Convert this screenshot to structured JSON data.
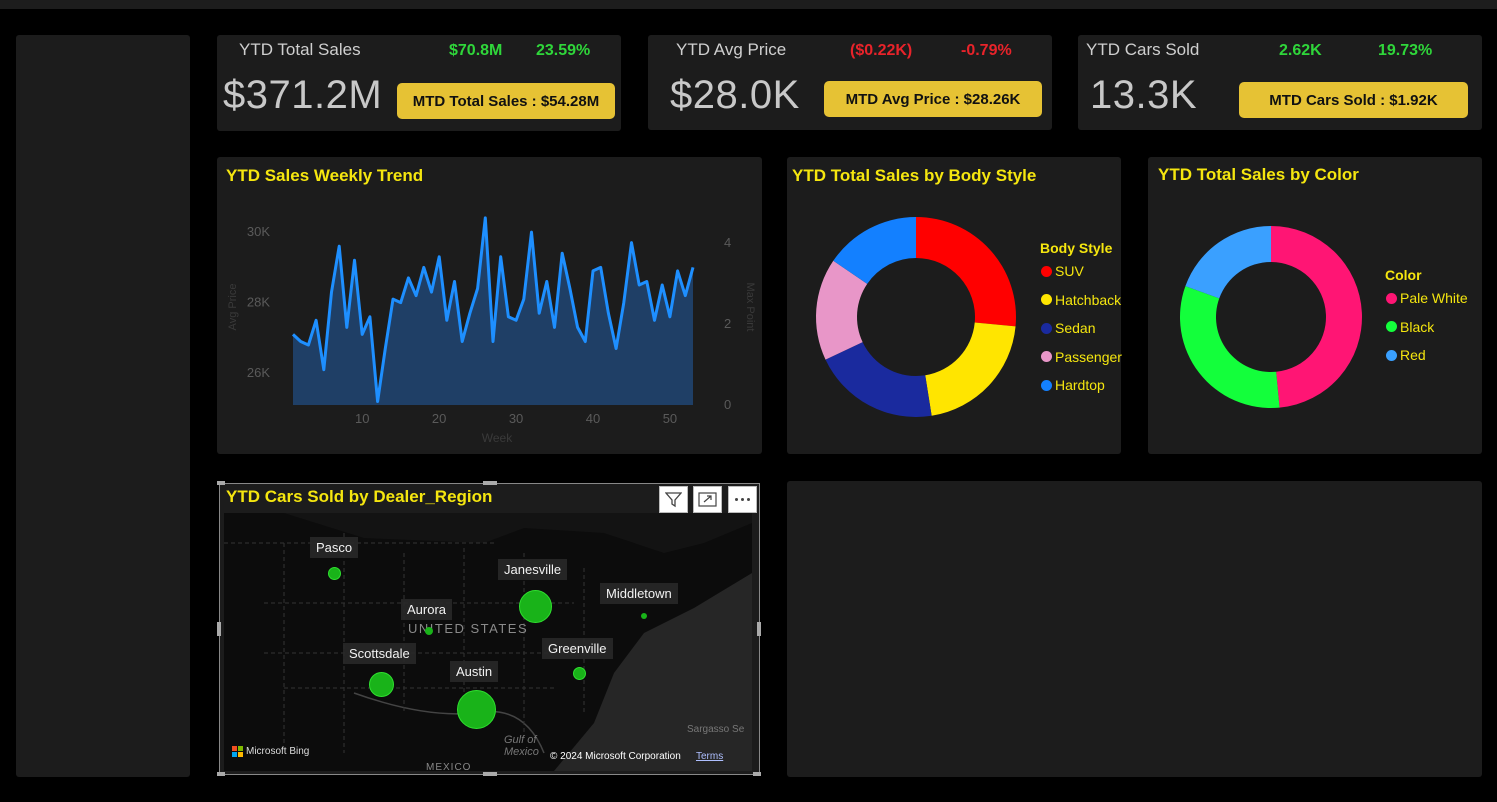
{
  "kpis": {
    "sales": {
      "label": "YTD Total Sales",
      "value": "$371.2M",
      "delta_abs": "$70.8M",
      "delta_pct": "23.59%",
      "mtd": "MTD Total Sales : $54.28M"
    },
    "price": {
      "label": "YTD Avg Price",
      "value": "$28.0K",
      "delta_abs": "($0.22K)",
      "delta_pct": "-0.79%",
      "mtd": "MTD Avg Price : $28.26K"
    },
    "cars": {
      "label": "YTD Cars Sold",
      "value": "13.3K",
      "delta_abs": "2.62K",
      "delta_pct": "19.73%",
      "mtd": "MTD Cars Sold : $1.92K"
    }
  },
  "colors": {
    "positive": "#2fd63a",
    "negative": "#e8232a",
    "accent": "#f5e60f",
    "button": "#e6c234",
    "line": "#1e8fff",
    "area": "#1f3f66"
  },
  "trend": {
    "title": "YTD Sales Weekly Trend",
    "left_axis_label": "Avg Price",
    "right_axis_label": "Max Point",
    "x_label": "Week",
    "chart_data": {
      "type": "area",
      "x_ticks": [
        "10",
        "20",
        "30",
        "40",
        "50"
      ],
      "y_ticks": [
        "26K",
        "28K",
        "30K"
      ],
      "y2_ticks": [
        "0",
        "2",
        "4"
      ],
      "x_range": [
        1,
        53
      ],
      "y_range": [
        25100,
        30200
      ],
      "x": [
        1,
        2,
        3,
        4,
        5,
        6,
        7,
        8,
        9,
        10,
        11,
        12,
        13,
        14,
        15,
        16,
        17,
        18,
        19,
        20,
        21,
        22,
        23,
        24,
        25,
        26,
        27,
        28,
        29,
        30,
        31,
        32,
        33,
        34,
        35,
        36,
        37,
        38,
        39,
        40,
        41,
        42,
        43,
        44,
        45,
        46,
        47,
        48,
        49,
        50,
        51,
        52,
        53
      ],
      "values": [
        27100,
        26900,
        26800,
        27500,
        26100,
        28300,
        29600,
        27300,
        29200,
        27100,
        27600,
        25200,
        26700,
        28100,
        28000,
        28700,
        28200,
        29000,
        28300,
        29300,
        27500,
        28600,
        26900,
        27700,
        28400,
        30400,
        26900,
        29300,
        27600,
        27500,
        28100,
        30000,
        27700,
        28600,
        27300,
        29400,
        28400,
        27300,
        26900,
        28900,
        29000,
        27700,
        26700,
        28000,
        29700,
        28500,
        28600,
        27500,
        28500,
        27600,
        28900,
        28200,
        29000
      ]
    }
  },
  "body_style": {
    "title": "YTD Total Sales by Body Style",
    "legend_title": "Body Style",
    "chart_data": {
      "type": "pie",
      "categories": [
        "SUV",
        "Hatchback",
        "Sedan",
        "Passenger",
        "Hardtop"
      ],
      "values": [
        26.5,
        21.0,
        20.5,
        16.5,
        15.5
      ],
      "colors": [
        "#ff0000",
        "#ffe500",
        "#1a2a9e",
        "#e896c8",
        "#1380ff"
      ]
    }
  },
  "color_chart": {
    "title": "YTD Total Sales by Color",
    "legend_title": "Color",
    "chart_data": {
      "type": "pie",
      "categories": [
        "Pale White",
        "Black",
        "Red"
      ],
      "values": [
        48.5,
        32.0,
        19.5
      ],
      "colors": [
        "#ff1574",
        "#13ff3b",
        "#3aa0ff"
      ]
    }
  },
  "map": {
    "title": "YTD Cars Sold by Dealer_Region",
    "country_label": "UNITED STATES",
    "gulf_label": "Gulf of Mexico",
    "mexico_label": "MEXICO",
    "sea_label": "Sargasso Se",
    "bing": "Microsoft Bing",
    "copyright": "© 2024 Microsoft Corporation",
    "terms": "Terms",
    "regions": [
      {
        "name": "Pasco"
      },
      {
        "name": "Janesville"
      },
      {
        "name": "Middletown"
      },
      {
        "name": "Aurora"
      },
      {
        "name": "Scottsdale"
      },
      {
        "name": "Austin"
      },
      {
        "name": "Greenville"
      }
    ]
  }
}
